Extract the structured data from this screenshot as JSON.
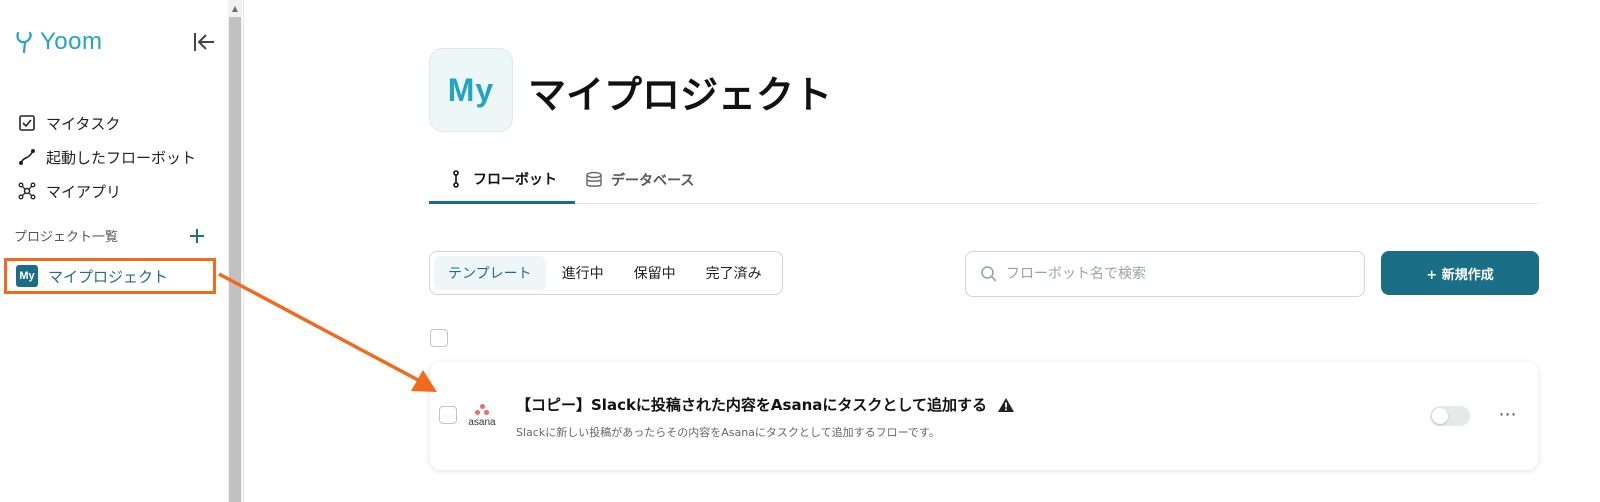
{
  "app": {
    "brand_name": "Yoom",
    "accent_color": "#1a6f86",
    "brand_color": "#23a4c4",
    "highlight_color": "#f26a1b"
  },
  "sidebar": {
    "nav_items": [
      {
        "label": "マイタスク",
        "icon": "checkbox-icon"
      },
      {
        "label": "起動したフローボット",
        "icon": "flow-icon"
      },
      {
        "label": "マイアプリ",
        "icon": "apps-icon"
      }
    ],
    "section_label": "プロジェクト一覧",
    "project": {
      "badge": "My",
      "label": "マイプロジェクト"
    }
  },
  "main": {
    "avatar_text": "My",
    "title": "マイプロジェクト",
    "tabs": [
      {
        "label": "フローボット",
        "icon": "flowbot-icon",
        "active": true
      },
      {
        "label": "データベース",
        "icon": "database-icon",
        "active": false
      }
    ],
    "filters": [
      {
        "label": "テンプレート",
        "active": true
      },
      {
        "label": "進行中",
        "active": false
      },
      {
        "label": "保留中",
        "active": false
      },
      {
        "label": "完了済み",
        "active": false
      }
    ],
    "search_placeholder": "フローボット名で検索",
    "new_button": "+ 新規作成",
    "flows": [
      {
        "app": "asana",
        "title": "【コピー】Slackに投稿された内容をAsanaにタスクとして追加する",
        "description": "Slackに新しい投稿があったらその内容をAsanaにタスクとして追加するフローです。",
        "warning": true,
        "enabled": false
      }
    ]
  }
}
